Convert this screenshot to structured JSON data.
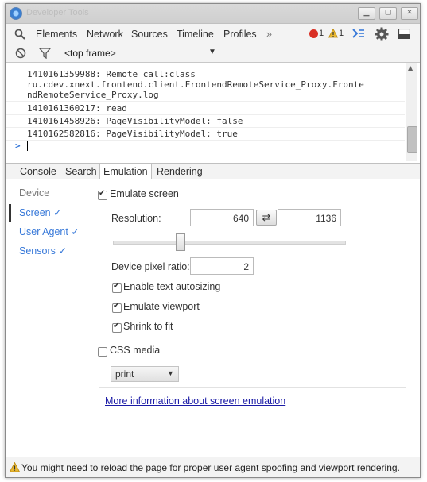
{
  "window": {
    "title": "Developer Tools"
  },
  "toolbar": {
    "tabs": [
      "Elements",
      "Network",
      "Sources",
      "Timeline",
      "Profiles"
    ],
    "more": "»",
    "error_count": "1",
    "warning_count": "1"
  },
  "context": {
    "frame_label": "<top frame>"
  },
  "console": {
    "lines": [
      "1410161359988: Remote call:class",
      "ru.cdev.xnext.frontend.client.FrontendRemoteService_Proxy.Fronte",
      "ndRemoteService_Proxy.log",
      "1410161360217: read",
      "1410161458926: PageVisibilityModel: false",
      "1410162582816: PageVisibilityModel: true"
    ],
    "prompt": ">"
  },
  "drawer": {
    "tabs": [
      "Console",
      "Search",
      "Emulation",
      "Rendering"
    ],
    "active": "Emulation"
  },
  "emulation": {
    "sidebar": [
      "Device",
      "Screen ✓",
      "User Agent ✓",
      "Sensors ✓"
    ],
    "emulate_screen": {
      "label": "Emulate screen",
      "checked": true
    },
    "resolution": {
      "label": "Resolution:",
      "width": "640",
      "height": "1136",
      "swap_icon": "⇄"
    },
    "device_pixel_ratio": {
      "label": "Device pixel ratio:",
      "value": "2"
    },
    "options": [
      {
        "label": "Enable text autosizing",
        "checked": true
      },
      {
        "label": "Emulate viewport",
        "checked": true
      },
      {
        "label": "Shrink to fit",
        "checked": true
      }
    ],
    "css_media": {
      "label": "CSS media",
      "checked": false,
      "selected": "print"
    },
    "more_info_link": "More information about screen emulation"
  },
  "status": {
    "icon": "warning-icon",
    "message": "You might need to reload the page for proper user agent spoofing and viewport rendering."
  },
  "colors": {
    "link": "#1a1aa6",
    "accent": "#3879d9",
    "error": "#d93025",
    "warning": "#e8a317"
  }
}
